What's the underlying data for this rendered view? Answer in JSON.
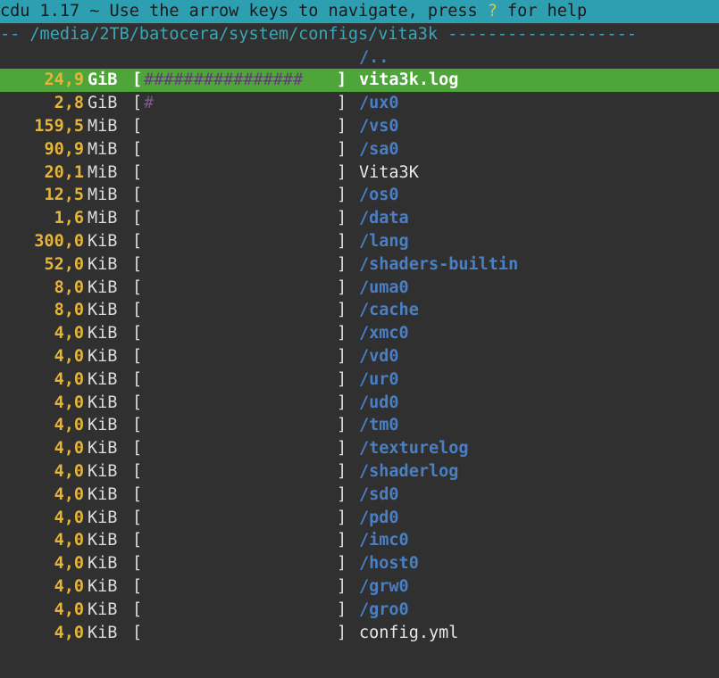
{
  "header": {
    "title_prefix": "cdu 1.17 ~ Use the arrow keys to navigate, press ",
    "help_key": "?",
    "title_suffix": " for help"
  },
  "path_bar": {
    "text": "-- /media/2TB/batocera/system/configs/vita3k ",
    "dashes": "-------------------"
  },
  "parent_entry": "/..",
  "rows": [
    {
      "size": "24,9",
      "unit": "GiB",
      "bar": "################",
      "name": "vita3k.log",
      "type": "file",
      "selected": true
    },
    {
      "size": "2,8",
      "unit": "GiB",
      "bar": "#",
      "name": "/ux0",
      "type": "dir"
    },
    {
      "size": "159,5",
      "unit": "MiB",
      "bar": "",
      "name": "/vs0",
      "type": "dir"
    },
    {
      "size": "90,9",
      "unit": "MiB",
      "bar": "",
      "name": "/sa0",
      "type": "dir"
    },
    {
      "size": "20,1",
      "unit": "MiB",
      "bar": "",
      "name": "Vita3K",
      "type": "file"
    },
    {
      "size": "12,5",
      "unit": "MiB",
      "bar": "",
      "name": "/os0",
      "type": "dir"
    },
    {
      "size": "1,6",
      "unit": "MiB",
      "bar": "",
      "name": "/data",
      "type": "dir"
    },
    {
      "size": "300,0",
      "unit": "KiB",
      "bar": "",
      "name": "/lang",
      "type": "dir"
    },
    {
      "size": "52,0",
      "unit": "KiB",
      "bar": "",
      "name": "/shaders-builtin",
      "type": "dir"
    },
    {
      "size": "8,0",
      "unit": "KiB",
      "bar": "",
      "name": "/uma0",
      "type": "dir"
    },
    {
      "size": "8,0",
      "unit": "KiB",
      "bar": "",
      "name": "/cache",
      "type": "dir"
    },
    {
      "size": "4,0",
      "unit": "KiB",
      "bar": "",
      "name": "/xmc0",
      "type": "dir"
    },
    {
      "size": "4,0",
      "unit": "KiB",
      "bar": "",
      "name": "/vd0",
      "type": "dir"
    },
    {
      "size": "4,0",
      "unit": "KiB",
      "bar": "",
      "name": "/ur0",
      "type": "dir"
    },
    {
      "size": "4,0",
      "unit": "KiB",
      "bar": "",
      "name": "/ud0",
      "type": "dir"
    },
    {
      "size": "4,0",
      "unit": "KiB",
      "bar": "",
      "name": "/tm0",
      "type": "dir"
    },
    {
      "size": "4,0",
      "unit": "KiB",
      "bar": "",
      "name": "/texturelog",
      "type": "dir"
    },
    {
      "size": "4,0",
      "unit": "KiB",
      "bar": "",
      "name": "/shaderlog",
      "type": "dir"
    },
    {
      "size": "4,0",
      "unit": "KiB",
      "bar": "",
      "name": "/sd0",
      "type": "dir"
    },
    {
      "size": "4,0",
      "unit": "KiB",
      "bar": "",
      "name": "/pd0",
      "type": "dir"
    },
    {
      "size": "4,0",
      "unit": "KiB",
      "bar": "",
      "name": "/imc0",
      "type": "dir"
    },
    {
      "size": "4,0",
      "unit": "KiB",
      "bar": "",
      "name": "/host0",
      "type": "dir"
    },
    {
      "size": "4,0",
      "unit": "KiB",
      "bar": "",
      "name": "/grw0",
      "type": "dir"
    },
    {
      "size": "4,0",
      "unit": "KiB",
      "bar": "",
      "name": "/gro0",
      "type": "dir"
    },
    {
      "size": "4,0",
      "unit": "KiB",
      "bar": "",
      "name": "config.yml",
      "type": "file"
    }
  ],
  "bar_open": "[",
  "bar_close": "]",
  "colors": {
    "header_bg": "#2e9fb1",
    "selected_bg": "#4ea63a",
    "size_color": "#e5b53a",
    "dir_color": "#4a7fc4",
    "background": "#303030"
  }
}
